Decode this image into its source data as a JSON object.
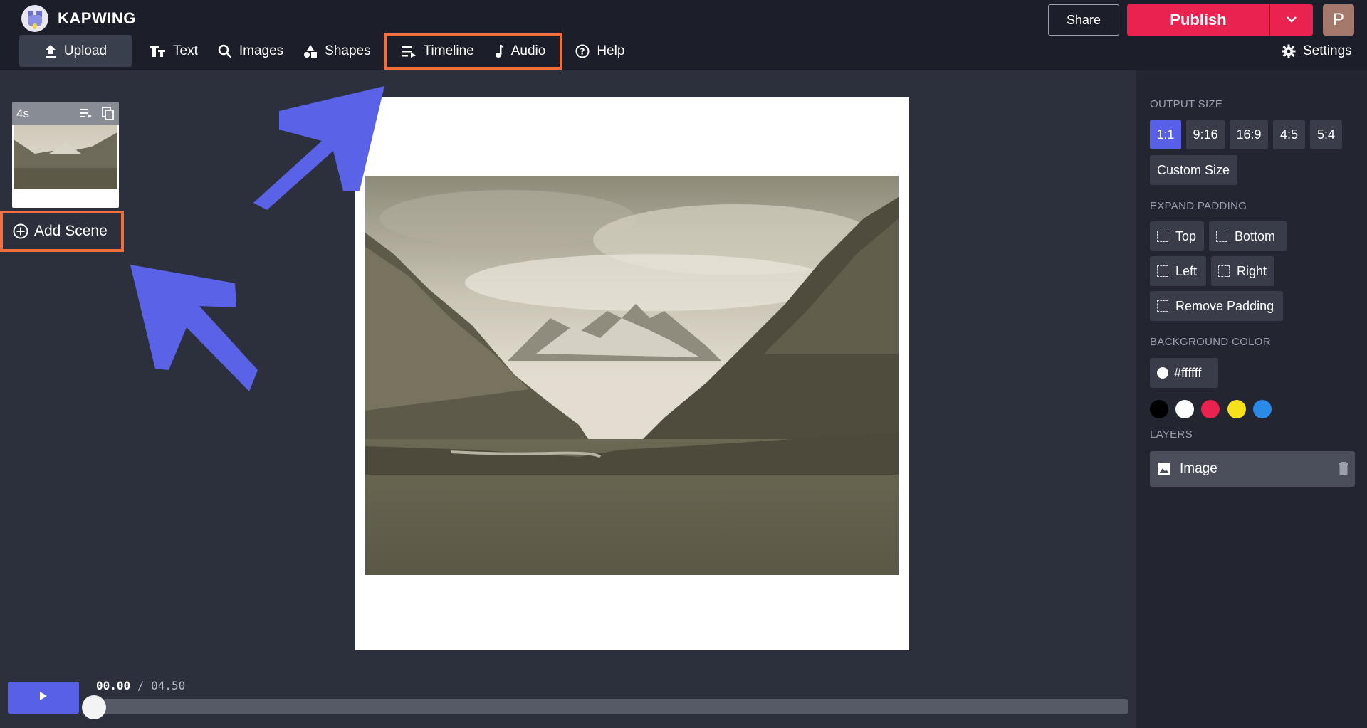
{
  "app": {
    "name": "KAPWING"
  },
  "toolbar": {
    "upload": "Upload",
    "text": "Text",
    "images": "Images",
    "shapes": "Shapes",
    "timeline": "Timeline",
    "audio": "Audio",
    "help": "Help"
  },
  "header": {
    "share": "Share",
    "publish": "Publish",
    "avatar_initial": "P",
    "settings": "Settings"
  },
  "scenes": {
    "items": [
      {
        "duration": "4s"
      }
    ],
    "add_scene": "Add Scene"
  },
  "playback": {
    "current": "00.00",
    "separator": "/",
    "total": "04.50",
    "progress": 0.0
  },
  "right_panel": {
    "output_size_label": "OUTPUT SIZE",
    "sizes": [
      "1:1",
      "9:16",
      "16:9",
      "4:5",
      "5:4"
    ],
    "active_size": "1:1",
    "custom_size": "Custom Size",
    "expand_padding_label": "EXPAND PADDING",
    "padding": {
      "top": "Top",
      "bottom": "Bottom",
      "left": "Left",
      "right": "Right",
      "remove": "Remove Padding"
    },
    "background_color_label": "BACKGROUND COLOR",
    "background_color": "#ffffff",
    "swatches": [
      "#000000",
      "#ffffff",
      "#e9224f",
      "#f7e11b",
      "#2a8ae8"
    ],
    "layers_label": "LAYERS",
    "layers": [
      {
        "name": "Image"
      }
    ]
  },
  "colors": {
    "accent": "#5760e6",
    "publish": "#e9224f",
    "highlight": "#f46f3e",
    "arrow": "#5a63e8"
  },
  "icons": [
    "upload-icon",
    "text-icon",
    "search-icon",
    "shapes-icon",
    "timeline-icon",
    "music-note-icon",
    "help-icon",
    "chevron-down-icon",
    "gear-icon",
    "plus-circle-icon",
    "play-icon",
    "image-icon",
    "trash-icon"
  ]
}
